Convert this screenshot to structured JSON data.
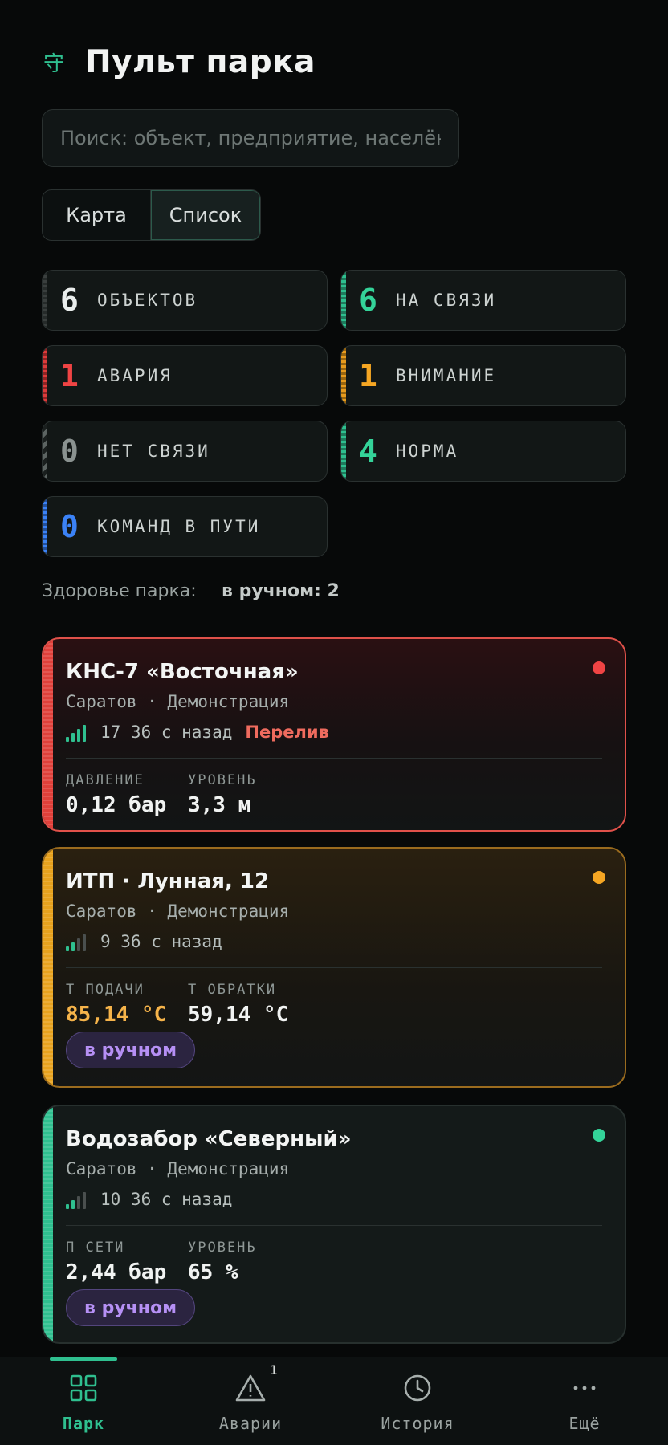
{
  "header": {
    "title": "Пульт парка",
    "logo_icon": "守"
  },
  "search": {
    "placeholder": "Поиск: объект, предприятие, населённый пункт",
    "value": ""
  },
  "view_toggle": {
    "map_label": "Карта",
    "list_label": "Список",
    "selected": "Список"
  },
  "stats": [
    {
      "value": "6",
      "label": "ОБЪЕКТОВ",
      "color": "#e9edec",
      "accent": "#3a3f3e"
    },
    {
      "value": "6",
      "label": "НА СВЯЗИ",
      "color": "#34d399",
      "accent": "#2fbf8f"
    },
    {
      "value": "1",
      "label": "АВАРИЯ",
      "color": "#ef4444",
      "accent": "#dc3b3b"
    },
    {
      "value": "1",
      "label": "ВНИМАНИЕ",
      "color": "#f5a623",
      "accent": "#e79b1e"
    },
    {
      "value": "0",
      "label": "НЕТ СВЯЗИ",
      "color": "#8a9290",
      "accent": "#5c6462"
    },
    {
      "value": "4",
      "label": "НОРМА",
      "color": "#34d399",
      "accent": "#2fbf8f"
    },
    {
      "value": "0",
      "label": "КОМАНД В ПУТИ",
      "color": "#3b82f6",
      "accent": "#3b82f6"
    }
  ],
  "health": {
    "label": "Здоровье парка:",
    "manual": "в ручном: 2"
  },
  "cards": [
    {
      "name": "КНС-7 «Восточная»",
      "location": "Саратов · Демонстрация",
      "signal_bars": 4,
      "since": "17 36 с назад",
      "alert": "Перелив",
      "status_color": "#ef4444",
      "metrics": [
        {
          "label": "ДАВЛЕНИЕ",
          "value": "0,12 бар"
        },
        {
          "label": "УРОВЕНЬ",
          "value": "3,3 м"
        }
      ],
      "pill": ""
    },
    {
      "name": "ИТП · Лунная, 12",
      "location": "Саратов · Демонстрация",
      "signal_bars": 2,
      "since": "9 36 с назад",
      "alert": "",
      "status_color": "#f5a623",
      "metrics": [
        {
          "label": "Т ПОДАЧИ",
          "value": "85,14 °C",
          "highlight": "#f5b34a"
        },
        {
          "label": "Т ОБРАТКИ",
          "value": "59,14 °C"
        }
      ],
      "pill": "в ручном"
    },
    {
      "name": "Водозабор «Северный»",
      "location": "Саратов · Демонстрация",
      "signal_bars": 2,
      "since": "10 36 с назад",
      "alert": "",
      "status_color": "#34d399",
      "metrics": [
        {
          "label": "П СЕТИ",
          "value": "2,44 бар"
        },
        {
          "label": "УРОВЕНЬ",
          "value": "65 %"
        }
      ],
      "pill": "в ручном"
    }
  ],
  "nav": [
    {
      "label": "Парк",
      "icon": "grid-icon",
      "active": true
    },
    {
      "label": "Аварии",
      "icon": "warning-icon",
      "badge": "1"
    },
    {
      "label": "История",
      "icon": "clock-icon"
    },
    {
      "label": "Ещё",
      "icon": "more-icon"
    }
  ]
}
